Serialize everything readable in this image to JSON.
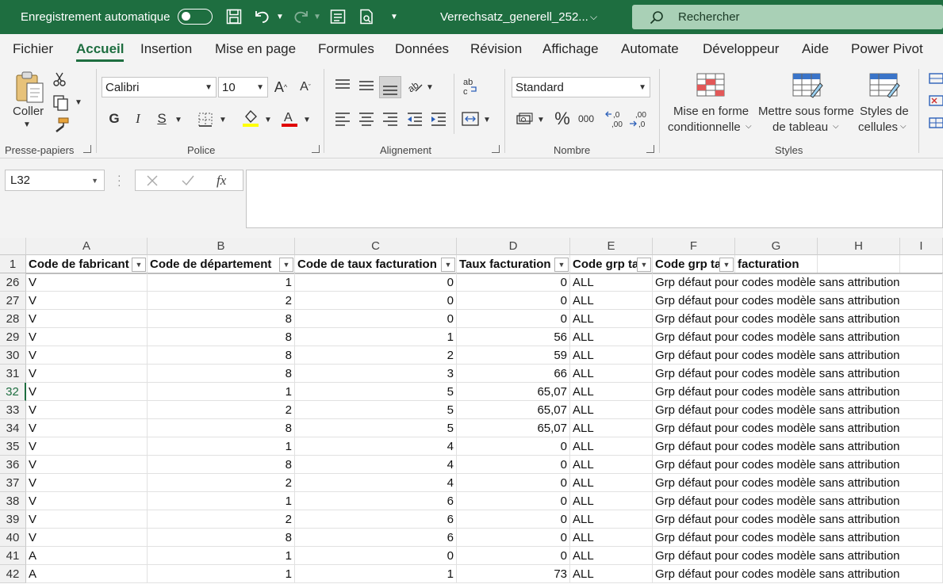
{
  "titlebar": {
    "autosave_label": "Enregistrement automatique",
    "filename": "Verrechsatz_generell_252...",
    "search_placeholder": "Rechercher"
  },
  "menu": [
    "Fichier",
    "Accueil",
    "Insertion",
    "Mise en page",
    "Formules",
    "Données",
    "Révision",
    "Affichage",
    "Automate",
    "Développeur",
    "Aide",
    "Power Pivot"
  ],
  "menu_active": "Accueil",
  "ribbon": {
    "clipboard": {
      "paste": "Coller",
      "label": "Presse-papiers"
    },
    "font": {
      "name": "Calibri",
      "size": "10",
      "bold": "G",
      "italic": "I",
      "underline": "S",
      "label": "Police"
    },
    "alignment": {
      "label": "Alignement"
    },
    "number": {
      "format": "Standard",
      "percent": "%",
      "thousands": "000",
      "label": "Nombre"
    },
    "styles": {
      "conditional": [
        "Mise en forme",
        "conditionnelle"
      ],
      "as_table": [
        "Mettre sous forme",
        "de tableau"
      ],
      "cell_styles": [
        "Styles de",
        "cellules"
      ],
      "label": "Styles"
    }
  },
  "formula_bar": {
    "name_box": "L32",
    "fx": "fx",
    "content": ""
  },
  "columns": [
    "A",
    "B",
    "C",
    "D",
    "E",
    "F",
    "G",
    "H",
    "I"
  ],
  "headers": [
    "Code de fabricant",
    "Code de département",
    "Code de taux facturation",
    "Taux facturation",
    "Code grp ta",
    "Code grp ta",
    "facturation"
  ],
  "selected_row": "32",
  "rows": [
    {
      "n": "26",
      "a": "V",
      "b": "1",
      "c": "0",
      "d": "0",
      "e": "ALL",
      "f": "Grp défaut pour codes modèle sans attribution"
    },
    {
      "n": "27",
      "a": "V",
      "b": "2",
      "c": "0",
      "d": "0",
      "e": "ALL",
      "f": "Grp défaut pour codes modèle sans attribution"
    },
    {
      "n": "28",
      "a": "V",
      "b": "8",
      "c": "0",
      "d": "0",
      "e": "ALL",
      "f": "Grp défaut pour codes modèle sans attribution"
    },
    {
      "n": "29",
      "a": "V",
      "b": "8",
      "c": "1",
      "d": "56",
      "e": "ALL",
      "f": "Grp défaut pour codes modèle sans attribution"
    },
    {
      "n": "30",
      "a": "V",
      "b": "8",
      "c": "2",
      "d": "59",
      "e": "ALL",
      "f": "Grp défaut pour codes modèle sans attribution"
    },
    {
      "n": "31",
      "a": "V",
      "b": "8",
      "c": "3",
      "d": "66",
      "e": "ALL",
      "f": "Grp défaut pour codes modèle sans attribution"
    },
    {
      "n": "32",
      "a": "V",
      "b": "1",
      "c": "5",
      "d": "65,07",
      "e": "ALL",
      "f": "Grp défaut pour codes modèle sans attribution"
    },
    {
      "n": "33",
      "a": "V",
      "b": "2",
      "c": "5",
      "d": "65,07",
      "e": "ALL",
      "f": "Grp défaut pour codes modèle sans attribution"
    },
    {
      "n": "34",
      "a": "V",
      "b": "8",
      "c": "5",
      "d": "65,07",
      "e": "ALL",
      "f": "Grp défaut pour codes modèle sans attribution"
    },
    {
      "n": "35",
      "a": "V",
      "b": "1",
      "c": "4",
      "d": "0",
      "e": "ALL",
      "f": "Grp défaut pour codes modèle sans attribution"
    },
    {
      "n": "36",
      "a": "V",
      "b": "8",
      "c": "4",
      "d": "0",
      "e": "ALL",
      "f": "Grp défaut pour codes modèle sans attribution"
    },
    {
      "n": "37",
      "a": "V",
      "b": "2",
      "c": "4",
      "d": "0",
      "e": "ALL",
      "f": "Grp défaut pour codes modèle sans attribution"
    },
    {
      "n": "38",
      "a": "V",
      "b": "1",
      "c": "6",
      "d": "0",
      "e": "ALL",
      "f": "Grp défaut pour codes modèle sans attribution"
    },
    {
      "n": "39",
      "a": "V",
      "b": "2",
      "c": "6",
      "d": "0",
      "e": "ALL",
      "f": "Grp défaut pour codes modèle sans attribution"
    },
    {
      "n": "40",
      "a": "V",
      "b": "8",
      "c": "6",
      "d": "0",
      "e": "ALL",
      "f": "Grp défaut pour codes modèle sans attribution"
    },
    {
      "n": "41",
      "a": "A",
      "b": "1",
      "c": "0",
      "d": "0",
      "e": "ALL",
      "f": "Grp défaut pour codes modèle sans attribution"
    },
    {
      "n": "42",
      "a": "A",
      "b": "1",
      "c": "1",
      "d": "73",
      "e": "ALL",
      "f": "Grp défaut pour codes modèle sans attribution"
    }
  ],
  "header_row_number": "1",
  "colors": {
    "accent": "#1e6e40",
    "search_bg": "#a9d0b6"
  }
}
